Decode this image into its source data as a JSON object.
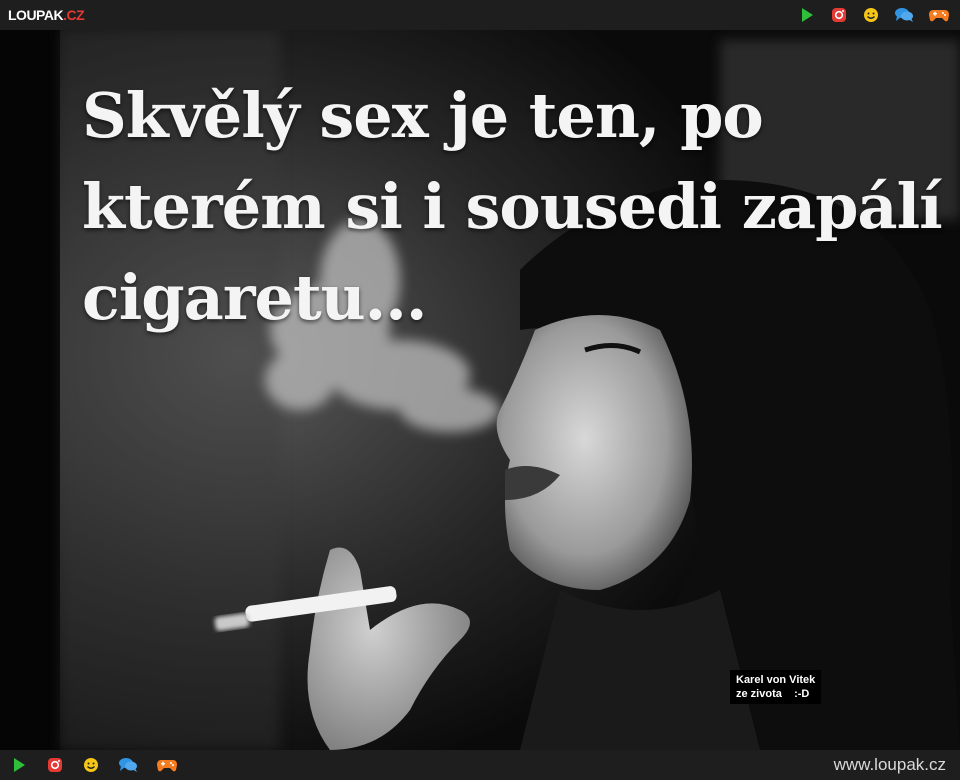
{
  "header": {
    "logo_main": "LOUPAK",
    "logo_suffix": ".CZ",
    "icons": [
      "play-icon",
      "instagram-icon",
      "smiley-icon",
      "chat-icon",
      "gamepad-icon"
    ]
  },
  "meme": {
    "caption_lines": [
      "Skvělý sex je ten, po",
      "kterém si i sousedi zapálí",
      "cigaretu..."
    ],
    "credit_line1": "Karel von Vitek",
    "credit_line2": "ze zivota    :-D"
  },
  "footer": {
    "icons": [
      "play-icon",
      "instagram-icon",
      "smiley-icon",
      "chat-icon",
      "gamepad-icon"
    ],
    "site_url": "www.loupak.cz"
  },
  "colors": {
    "bar_bg": "#1e1e1e",
    "play_green": "#2fbf3b",
    "instagram_red": "#e53935",
    "smiley_yellow": "#f5c518",
    "chat_blue": "#2f95e3",
    "gamepad_orange": "#f57c20"
  }
}
